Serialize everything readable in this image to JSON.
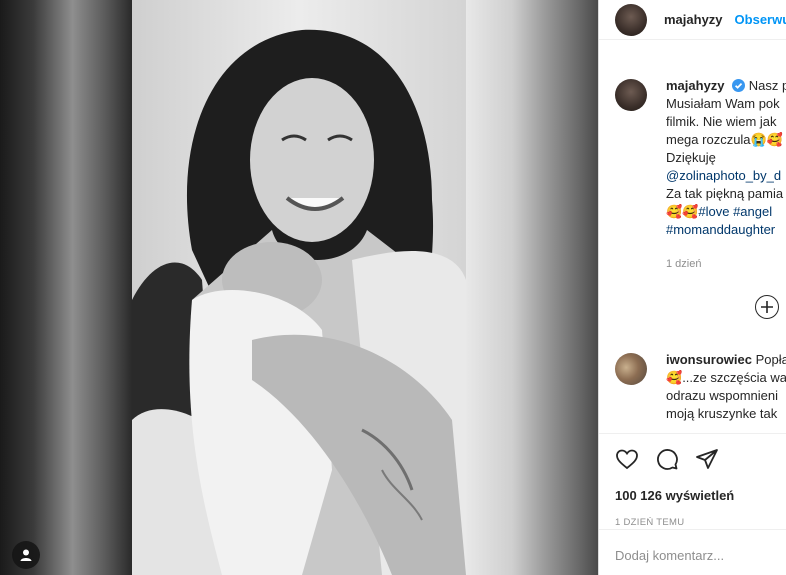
{
  "post": {
    "username": "majahyzy",
    "follow_label": "Obserwuj"
  },
  "caption": {
    "username": "majahyzy",
    "line1_tail": "Nasz p",
    "line2": "Musiałam Wam pok",
    "line3": "filmik. Nie wiem jak",
    "line4_text": "mega rozczula",
    "line4_emoji": "😭🥰",
    "line5": "Dziękuję",
    "line6_tag": "@zolinaphoto_by_d",
    "line7": "Za tak piękną pamia",
    "line8_emoji": "🥰🥰",
    "line8_tags": "#love #angel",
    "line9_tag": "#momanddaughter",
    "time": "1 dzień"
  },
  "comment": {
    "username": "iwonsurowiec",
    "line1_tail": "Popła",
    "line2_emoji": "🥰",
    "line2_text": "...ze szczęścia wa",
    "line3": "odrazu wspomnieni",
    "line4": "moją kruszynke tak"
  },
  "stats": {
    "views": "100 126 wyświetleń",
    "date": "1 dzień temu"
  },
  "add_comment": {
    "placeholder": "Dodaj komentarz..."
  },
  "colors": {
    "accent": "#0095f6",
    "hashtag": "#00376b",
    "muted": "#8e8e8e"
  },
  "icons": [
    "user-tag-icon",
    "verified-badge-icon",
    "heart-icon",
    "comment-icon",
    "share-icon",
    "load-more-icon"
  ]
}
